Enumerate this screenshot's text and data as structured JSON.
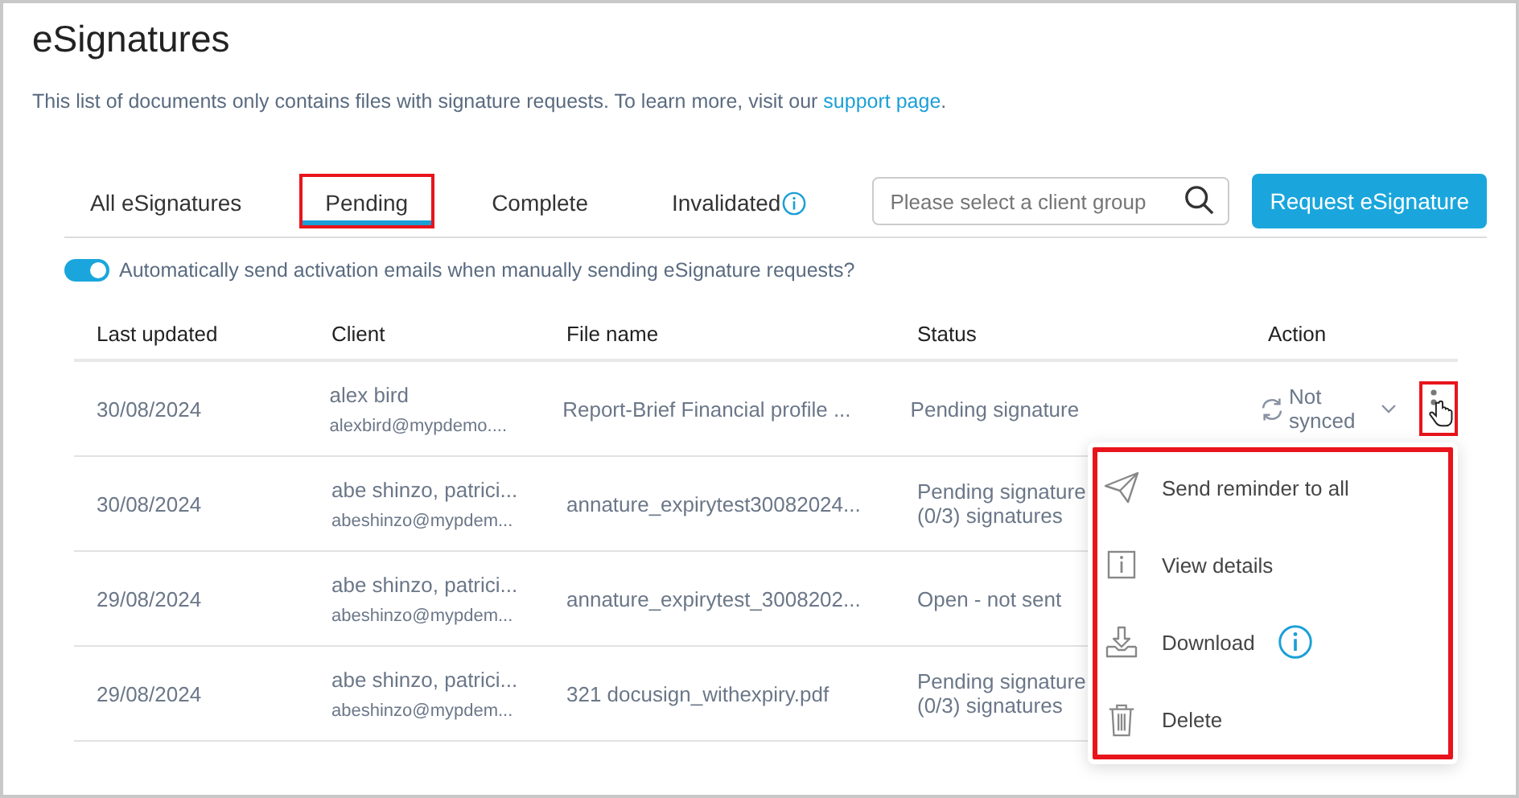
{
  "page": {
    "title": "eSignatures",
    "intro": "This list of documents only contains files with signature requests. To learn more, visit our ",
    "intro_link": "support page",
    "intro_end": "."
  },
  "tabs": [
    {
      "label": "All eSignatures",
      "selected": false,
      "highlighted": false,
      "info": false
    },
    {
      "label": "Pending",
      "selected": true,
      "highlighted": true,
      "info": false
    },
    {
      "label": "Complete",
      "selected": false,
      "highlighted": false,
      "info": false
    },
    {
      "label": "Invalidated",
      "selected": false,
      "highlighted": false,
      "info": true
    }
  ],
  "search": {
    "placeholder": "Please select a client group"
  },
  "request_button": "Request eSignature",
  "auto_email": {
    "on": true,
    "label": "Automatically send activation emails when manually sending eSignature requests?"
  },
  "table": {
    "columns": [
      "Last updated",
      "Client",
      "File name",
      "Status",
      "Action"
    ],
    "rows": [
      {
        "date": "30/08/2024",
        "client": "alex bird",
        "email": "alexbird@mypdemo....",
        "file": "Report-Brief Financial profile ...",
        "status": [
          "Pending signature"
        ],
        "action": "Not synced",
        "more_highlighted": true
      },
      {
        "date": "30/08/2024",
        "client": "abe shinzo, patrici...",
        "email": "abeshinzo@mypdem...",
        "file": "annature_expirytest30082024...",
        "status": [
          "Pending signature",
          "(0/3) signatures"
        ]
      },
      {
        "date": "29/08/2024",
        "client": "abe shinzo, patrici...",
        "email": "abeshinzo@mypdem...",
        "file": "annature_expirytest_3008202...",
        "status": [
          "Open - not sent"
        ]
      },
      {
        "date": "29/08/2024",
        "client": "abe shinzo, patrici...",
        "email": "abeshinzo@mypdem...",
        "file": "321 docusign_withexpiry.pdf",
        "status": [
          "Pending signature",
          "(0/3) signatures"
        ]
      }
    ]
  },
  "action_menu": {
    "highlighted": true,
    "items": [
      {
        "kind": "send",
        "label": "Send reminder to all",
        "info": false
      },
      {
        "kind": "details",
        "label": "View details",
        "info": false
      },
      {
        "kind": "download",
        "label": "Download",
        "info": true
      },
      {
        "kind": "delete",
        "label": "Delete",
        "info": false
      }
    ]
  }
}
